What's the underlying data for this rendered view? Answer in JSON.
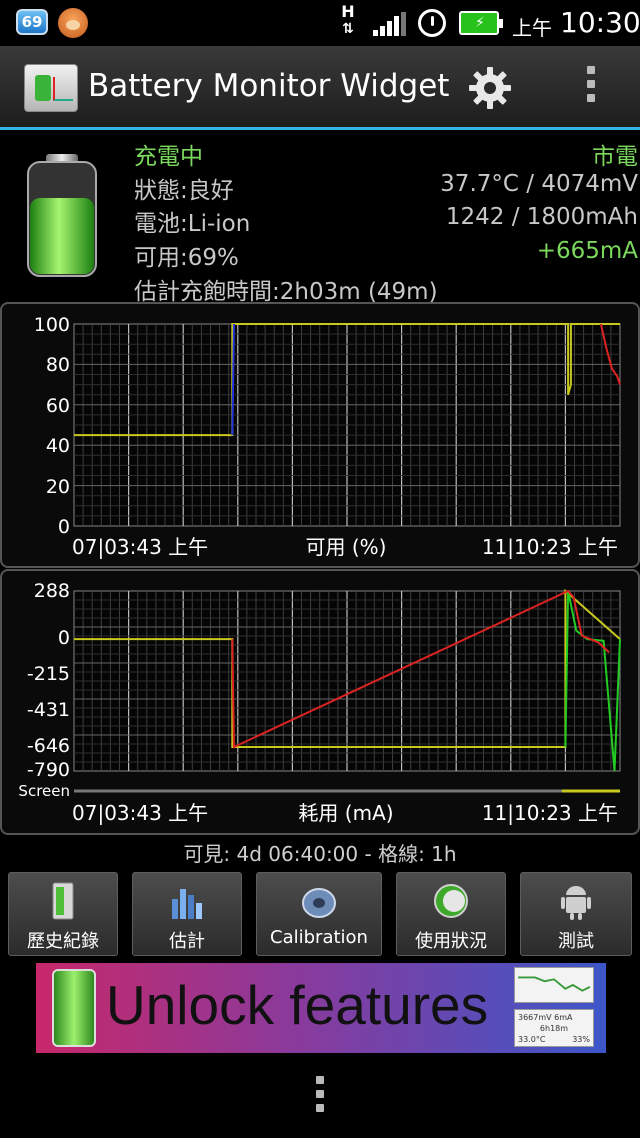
{
  "status_bar": {
    "notification_count": "69",
    "network_type": "H",
    "ampm": "上午",
    "time": "10:30"
  },
  "app_bar": {
    "title": "Battery Monitor Widget",
    "settings_icon": "gear-icon",
    "overflow_icon": "overflow-menu-icon"
  },
  "battery_info": {
    "charging_status": "充電中",
    "power_source": "市電",
    "state": "狀態:良好",
    "temp_voltage": "37.7°C / 4074mV",
    "battery_type": "電池:Li-ion",
    "capacity": "1242 / 1800mAh",
    "available": "可用:69%",
    "current": "+665mA",
    "time_to_full": "估計充飽時間:2h03m (49m)",
    "level_fraction": 0.69
  },
  "charts": {
    "percent": {
      "y_ticks": [
        "100",
        "80",
        "60",
        "40",
        "20",
        "0"
      ],
      "start_label": "07|03:43 上午",
      "end_label": "11|10:23 上午",
      "axis_label": "可用 (%)"
    },
    "current": {
      "y_ticks": [
        "288",
        "0",
        "-215",
        "-431",
        "-646",
        "-790"
      ],
      "screen_label": "Screen",
      "start_label": "07|03:43 上午",
      "end_label": "11|10:23 上午",
      "axis_label": "耗用 (mA)"
    }
  },
  "chart_data": [
    {
      "type": "line",
      "title": "",
      "xlabel": "可用 (%)",
      "ylabel": "",
      "x_range": [
        "07|03:43 上午",
        "11|10:23 上午"
      ],
      "ylim": [
        0,
        100
      ],
      "grid": true,
      "series": [
        {
          "color": "#c8c81e",
          "x": [
            0,
            0.29,
            0.29,
            0.905,
            0.905,
            0.91,
            0.91,
            1.0
          ],
          "values": [
            45,
            45,
            100,
            100,
            65,
            70,
            100,
            100
          ]
        },
        {
          "color": "#2233dd",
          "x": [
            0.29,
            0.293
          ],
          "values": [
            45,
            100
          ]
        },
        {
          "color": "#dd2222",
          "x": [
            0.965,
            0.975,
            0.985,
            0.995,
            1.0
          ],
          "values": [
            100,
            88,
            78,
            74,
            70
          ]
        }
      ]
    },
    {
      "type": "line",
      "title": "",
      "xlabel": "耗用 (mA)",
      "ylabel": "",
      "x_range": [
        "07|03:43 上午",
        "11|10:23 上午"
      ],
      "ylim": [
        -790,
        288
      ],
      "grid": true,
      "series": [
        {
          "color": "#c8c81e",
          "x": [
            0,
            0.29,
            0.29,
            0.9,
            0.9,
            1.0
          ],
          "values": [
            0,
            0,
            -646,
            -646,
            288,
            0
          ]
        },
        {
          "color": "#22cc22",
          "x": [
            0.9,
            0.905,
            0.92,
            0.94,
            0.97,
            0.99,
            1.0
          ],
          "values": [
            -646,
            288,
            50,
            0,
            -10,
            -790,
            0
          ]
        },
        {
          "color": "#dd2222",
          "x": [
            0.29,
            0.293,
            0.905,
            0.915,
            0.93,
            0.96,
            0.98
          ],
          "values": [
            0,
            -646,
            288,
            250,
            20,
            -20,
            -80
          ]
        }
      ]
    }
  ],
  "footer": {
    "visible_range": "可見: 4d 06:40:00 - 格線: 1h"
  },
  "buttons": [
    {
      "label": "歷史紀錄",
      "icon": "history-book-icon"
    },
    {
      "label": "估計",
      "icon": "estimate-chart-icon"
    },
    {
      "label": "Calibration",
      "icon": "calibration-disc-icon"
    },
    {
      "label": "使用狀況",
      "icon": "usage-gauge-icon"
    },
    {
      "label": "測試",
      "icon": "android-robot-icon"
    }
  ],
  "banner": {
    "text": "Unlock features",
    "mini_values": "3667mV  6mA",
    "mini_time": "6h18m",
    "mini_temp": "33.0°C",
    "mini_pct": "33%"
  },
  "colors": {
    "accent": "#33b5e5",
    "charging_green": "#7cd85d",
    "line_yellow": "#c8c81e",
    "line_blue": "#2233dd",
    "line_red": "#dd2222",
    "line_green": "#22cc22"
  }
}
